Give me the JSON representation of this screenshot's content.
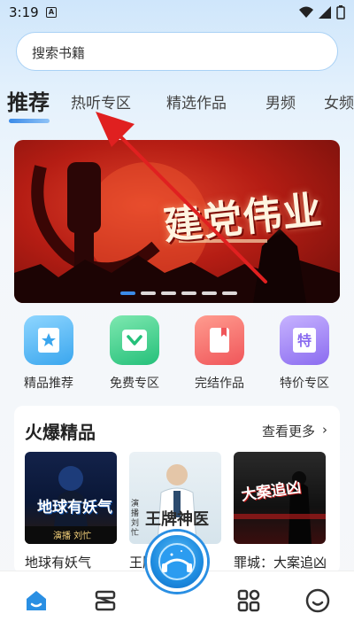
{
  "status_bar": {
    "time": "3:19",
    "badge": "A"
  },
  "search": {
    "placeholder": "搜索书籍"
  },
  "tabs": [
    {
      "label": "推荐",
      "active": true
    },
    {
      "label": "热听专区"
    },
    {
      "label": "精选作品"
    },
    {
      "label": "男频"
    },
    {
      "label": "女频"
    }
  ],
  "banner": {
    "title": "建党伟业",
    "slides": 6,
    "active_slide": 1
  },
  "quick_entries": [
    {
      "label": "精品推荐",
      "icon": "star-bookmark-icon",
      "color": "#4fb6f5"
    },
    {
      "label": "免费专区",
      "icon": "heart-gift-icon",
      "color": "#3fcf8e"
    },
    {
      "label": "完结作品",
      "icon": "book-icon",
      "color": "#f46b6b"
    },
    {
      "label": "特价专区",
      "icon": "discount-icon",
      "color": "#a58cf3"
    }
  ],
  "hot": {
    "title": "火爆精品",
    "more": "查看更多",
    "books": [
      {
        "title": "地球有妖气",
        "cover_text": "地球有妖气",
        "cover_sub": "演播 刘忙"
      },
      {
        "title": "王牌神医",
        "cover_text": "王牌神医",
        "cover_sub": "演播 刘忙"
      },
      {
        "title": "罪城：大案追凶",
        "cover_text": "大案追凶",
        "cover_sub": ""
      }
    ]
  },
  "bottom_nav": [
    "home-icon",
    "bookshelf-icon",
    "player-icon",
    "category-icon",
    "profile-icon"
  ],
  "colors": {
    "accent": "#2a8fe3",
    "annotation": "#e02020"
  }
}
